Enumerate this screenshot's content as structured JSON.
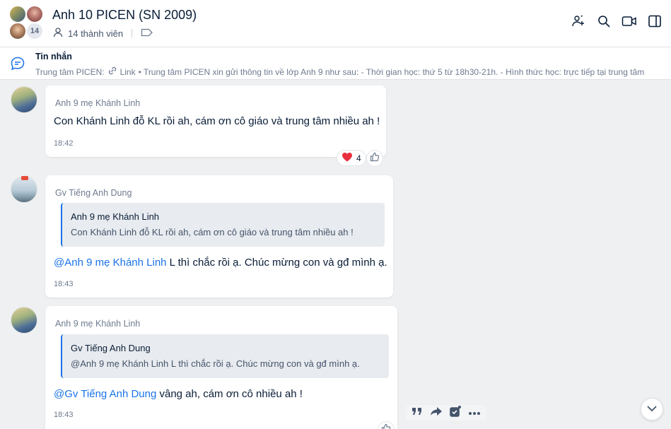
{
  "header": {
    "title": "Anh 10 PICEN (SN 2009)",
    "member_count_badge": "14",
    "members_label": "14 thành viên"
  },
  "pinned": {
    "title": "Tin nhắn",
    "sender": "Trung tâm PICEN:",
    "link_label": "Link",
    "preview": "• Trung tâm PICEN xin gửi thông tin về lớp Anh 9 như sau: - Thời gian học: thứ 5 từ 18h30-21h. - Hình thức học: trực tiếp tại trung tâm"
  },
  "messages": [
    {
      "sender": "Anh 9 mẹ Khánh Linh",
      "text": "Con Khánh Linh đỗ KL rồi ah, cám ơn cô giáo và trung tâm nhiều ah !",
      "time": "18:42",
      "reaction_count": "4"
    },
    {
      "sender": "Gv Tiếng Anh Dung",
      "quote_name": "Anh 9 mẹ Khánh Linh",
      "quote_text": "Con Khánh Linh đỗ KL rồi ah, cám ơn cô giáo và trung tâm nhiều ah !",
      "mention": "@Anh 9 mẹ Khánh Linh",
      "text": " L thì chắc rồi ạ. Chúc mừng con và gđ mình ạ.",
      "time": "18:43"
    },
    {
      "sender": "Anh 9 mẹ Khánh Linh",
      "quote_name": "Gv Tiếng Anh Dung",
      "quote_text": "@Anh 9 mẹ Khánh Linh L thì chắc rồi ạ. Chúc mừng con và gđ mình ạ.",
      "mention": "@Gv Tiếng Anh Dung",
      "text": " vâng ah, cám ơn cô nhiều ah !",
      "time": "18:43"
    }
  ],
  "colors": {
    "accent": "#1a73e8",
    "background": "#eef0f1",
    "reaction_heart": "#e8303f"
  }
}
